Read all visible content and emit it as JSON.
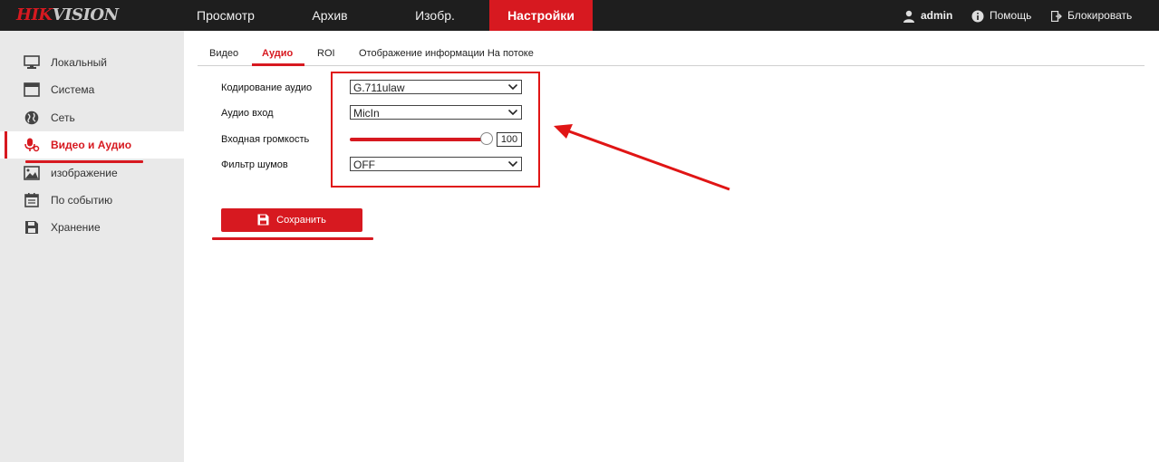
{
  "brand": {
    "logo_part1": "HIK",
    "logo_part2": "VISION"
  },
  "top_nav": [
    {
      "label": "Просмотр"
    },
    {
      "label": "Архив"
    },
    {
      "label": "Изобр."
    },
    {
      "label": "Настройки",
      "active": true
    }
  ],
  "top_right": {
    "user": "admin",
    "help": "Помощь",
    "lock": "Блокировать"
  },
  "sidebar": {
    "items": [
      {
        "label": "Локальный",
        "icon": "monitor-icon"
      },
      {
        "label": "Система",
        "icon": "window-icon"
      },
      {
        "label": "Сеть",
        "icon": "globe-icon"
      },
      {
        "label": "Видео и Аудио",
        "icon": "mic-icon",
        "active": true
      },
      {
        "label": "изображение",
        "icon": "image-icon"
      },
      {
        "label": "По событию",
        "icon": "calendar-icon"
      },
      {
        "label": "Хранение",
        "icon": "floppy-icon"
      }
    ]
  },
  "tabs": [
    {
      "label": "Видео"
    },
    {
      "label": "Аудио",
      "active": true
    },
    {
      "label": "ROI"
    },
    {
      "label": "Отображение информации На потоке"
    }
  ],
  "form": {
    "audio_encoding": {
      "label": "Кодирование аудио",
      "value": "G.711ulaw"
    },
    "audio_input": {
      "label": "Аудио вход",
      "value": "MicIn"
    },
    "input_volume": {
      "label": "Входная громкость",
      "value": "100",
      "level_percent": 100
    },
    "noise_filter": {
      "label": "Фильтр шумов",
      "value": "OFF"
    }
  },
  "save_button": {
    "label": "Сохранить"
  },
  "colors": {
    "accent": "#d71920",
    "topbar": "#1e1e1e",
    "sidebar": "#e9e9e9",
    "annotation": "#e01515"
  }
}
